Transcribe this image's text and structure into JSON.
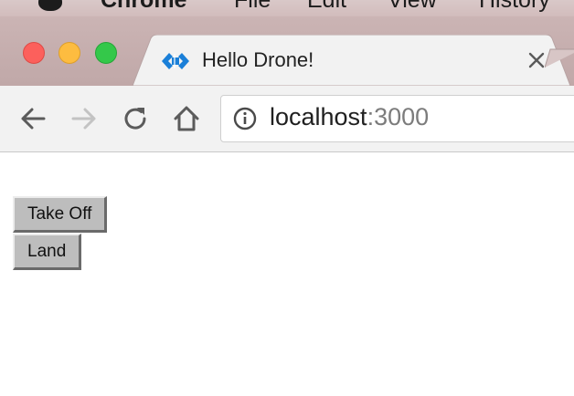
{
  "menubar": {
    "items": [
      "Chrome",
      "File",
      "Edit",
      "View",
      "History"
    ]
  },
  "tab": {
    "title": "Hello Drone!",
    "favicon": "drone-icon"
  },
  "toolbar": {
    "back_icon": "back-arrow-icon",
    "forward_icon": "forward-arrow-icon",
    "reload_icon": "reload-icon",
    "home_icon": "home-icon"
  },
  "address": {
    "host": "localhost",
    "port": ":3000",
    "info_icon": "info-icon"
  },
  "page": {
    "buttons": {
      "take_off": "Take Off",
      "land": "Land"
    }
  },
  "colors": {
    "favicon_blue": "#1a7fd8",
    "traffic_red": "#fc605c",
    "traffic_yellow": "#fdbc40",
    "traffic_green": "#34c84a"
  }
}
